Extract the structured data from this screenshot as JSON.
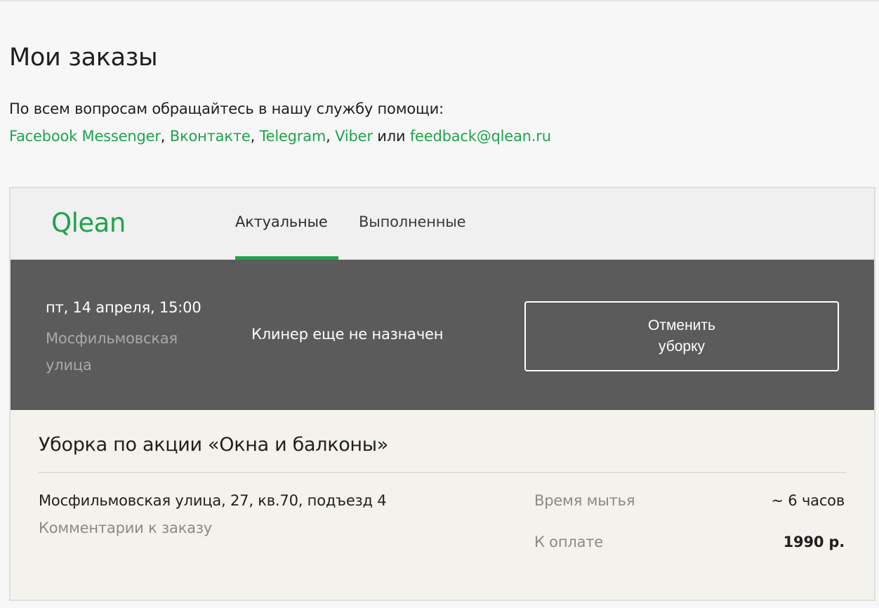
{
  "page": {
    "title": "Мои заказы",
    "help_text": "По всем вопросам обращайтесь в нашу службу помощи:",
    "help_links": {
      "facebook": "Facebook Messenger",
      "vk": "Вконтакте",
      "telegram": "Telegram",
      "viber": "Viber",
      "or": "или",
      "email": "feedback@qlean.ru",
      "comma": ","
    },
    "link_color": "#1fa34a"
  },
  "card": {
    "logo": "Qlean",
    "tabs": [
      {
        "label": "Актуальные",
        "active": true
      },
      {
        "label": "Выполненные",
        "active": false
      }
    ],
    "order": {
      "date": "пт, 14 апреля, 15:00",
      "street": "Мосфильмовская улица",
      "cleaner_status": "Клинер еще не назначен",
      "cancel_label": "Отменить уборку"
    },
    "details": {
      "service_title": "Уборка по акции «Окна и балконы»",
      "address": "Мосфильмовская улица, 27, кв.70, подъезд 4",
      "comments_link": "Комментарии к заказу",
      "wash_time_label": "Время мытья",
      "wash_time_value": "~ 6 часов",
      "payment_label": "К оплате",
      "payment_value": "1990 р."
    }
  }
}
